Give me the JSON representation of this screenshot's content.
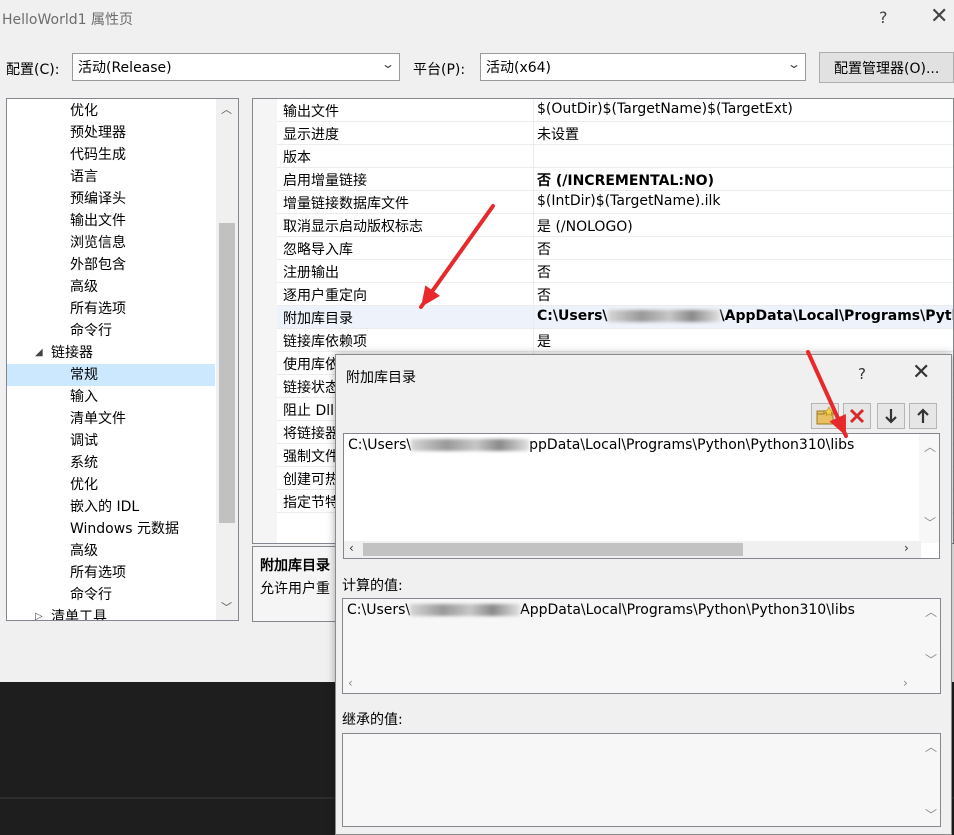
{
  "window": {
    "title": "HelloWorld1 属性页",
    "help": "?",
    "close": "✕"
  },
  "config_bar": {
    "config_label": "配置(C):",
    "config_value": "活动(Release)",
    "platform_label": "平台(P):",
    "platform_value": "活动(x64)",
    "manager_button": "配置管理器(O)..."
  },
  "tree": {
    "items": [
      {
        "label": "优化",
        "indent": 2
      },
      {
        "label": "预处理器",
        "indent": 2
      },
      {
        "label": "代码生成",
        "indent": 2
      },
      {
        "label": "语言",
        "indent": 2
      },
      {
        "label": "预编译头",
        "indent": 2
      },
      {
        "label": "输出文件",
        "indent": 2
      },
      {
        "label": "浏览信息",
        "indent": 2
      },
      {
        "label": "外部包含",
        "indent": 2
      },
      {
        "label": "高级",
        "indent": 2
      },
      {
        "label": "所有选项",
        "indent": 2
      },
      {
        "label": "命令行",
        "indent": 2
      },
      {
        "label": "链接器",
        "indent": 1,
        "expander": "◢"
      },
      {
        "label": "常规",
        "indent": 2,
        "selected": true
      },
      {
        "label": "输入",
        "indent": 2
      },
      {
        "label": "清单文件",
        "indent": 2
      },
      {
        "label": "调试",
        "indent": 2
      },
      {
        "label": "系统",
        "indent": 2
      },
      {
        "label": "优化",
        "indent": 2
      },
      {
        "label": "嵌入的 IDL",
        "indent": 2
      },
      {
        "label": "Windows 元数据",
        "indent": 2
      },
      {
        "label": "高级",
        "indent": 2
      },
      {
        "label": "所有选项",
        "indent": 2
      },
      {
        "label": "命令行",
        "indent": 2
      },
      {
        "label": "清单工具",
        "indent": 1,
        "expander": "▷"
      }
    ]
  },
  "properties": [
    {
      "name": "输出文件",
      "value": "$(OutDir)$(TargetName)$(TargetExt)"
    },
    {
      "name": "显示进度",
      "value": "未设置"
    },
    {
      "name": "版本",
      "value": ""
    },
    {
      "name": "启用增量链接",
      "value": "否 (/INCREMENTAL:NO)",
      "bold": true
    },
    {
      "name": "增量链接数据库文件",
      "value": "$(IntDir)$(TargetName).ilk"
    },
    {
      "name": "取消显示启动版权标志",
      "value": "是 (/NOLOGO)"
    },
    {
      "name": "忽略导入库",
      "value": "否"
    },
    {
      "name": "注册输出",
      "value": "否"
    },
    {
      "name": "逐用户重定向",
      "value": "否"
    },
    {
      "name": "附加库目录",
      "value_prefix": "C:\\Users\\",
      "value_suffix": "\\AppData\\Local\\Programs\\Pyth",
      "bold": true,
      "highlight": true
    },
    {
      "name": "链接库依赖项",
      "value": "是"
    },
    {
      "name": "使用库依",
      "value": ""
    },
    {
      "name": "链接状态",
      "value": ""
    },
    {
      "name": "阻止 Dll",
      "value": ""
    },
    {
      "name": "将链接器",
      "value": ""
    },
    {
      "name": "强制文件",
      "value": ""
    },
    {
      "name": "创建可热",
      "value": ""
    },
    {
      "name": "指定节特",
      "value": ""
    }
  ],
  "description": {
    "title": "附加库目录",
    "text": "允许用户重"
  },
  "dialog": {
    "title": "附加库目录",
    "help": "?",
    "close": "✕",
    "toolbar": [
      "new-folder-icon",
      "delete-icon",
      "move-down-icon",
      "move-up-icon"
    ],
    "entry_prefix": "C:\\Users\\",
    "entry_suffix": "ppData\\Local\\Programs\\Python\\Python310\\libs",
    "computed_label": "计算的值:",
    "computed_prefix": "C:\\Users\\",
    "computed_suffix": "AppData\\Local\\Programs\\Python\\Python310\\libs",
    "inherited_label": "继承的值:"
  },
  "annotation_color": "#e8282b"
}
